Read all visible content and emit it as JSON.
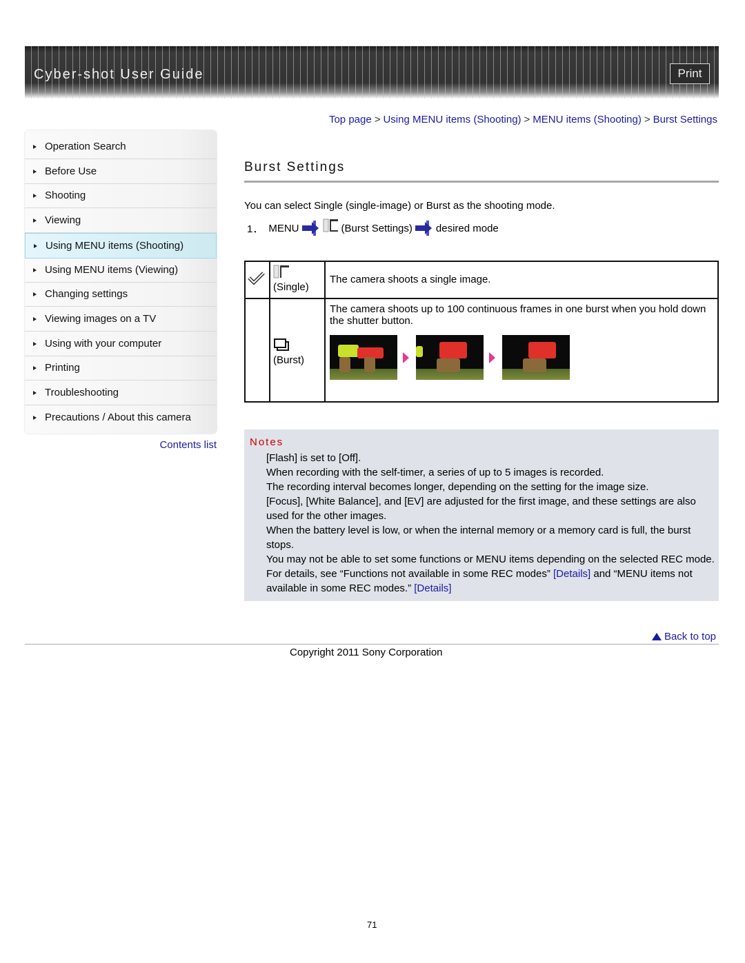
{
  "header": {
    "title": "Cyber-shot User Guide",
    "print_label": "Print"
  },
  "breadcrumb": [
    "Top page",
    "Using MENU items (Shooting)",
    "MENU items (Shooting)",
    "Burst Settings"
  ],
  "sidebar": {
    "items": [
      {
        "label": "Operation Search",
        "active": false
      },
      {
        "label": "Before Use",
        "active": false
      },
      {
        "label": "Shooting",
        "active": false
      },
      {
        "label": "Viewing",
        "active": false
      },
      {
        "label": "Using MENU items (Shooting)",
        "active": true
      },
      {
        "label": "Using MENU items (Viewing)",
        "active": false
      },
      {
        "label": "Changing settings",
        "active": false
      },
      {
        "label": "Viewing images on a TV",
        "active": false
      },
      {
        "label": "Using with your computer",
        "active": false
      },
      {
        "label": "Printing",
        "active": false
      },
      {
        "label": "Troubleshooting",
        "active": false
      },
      {
        "label": "Precautions / About this camera",
        "active": false
      }
    ],
    "contents_list": "Contents list"
  },
  "main": {
    "title": "Burst Settings",
    "intro": "You can select Single (single-image) or Burst as the shooting mode.",
    "step": {
      "number": "1．",
      "menu": "MENU",
      "setting": "(Burst Settings)",
      "target": "desired mode"
    },
    "modes": [
      {
        "label": "(Single)",
        "selected": true,
        "description": "The camera shoots a single image."
      },
      {
        "label": "(Burst)",
        "selected": false,
        "description": "The camera shoots up to 100 continuous frames in one burst when you hold down the shutter button."
      }
    ]
  },
  "notes": {
    "title": "Notes",
    "items": [
      "[Flash] is set to [Off].",
      "When recording with the self-timer, a series of up to 5 images is recorded.",
      "The recording interval becomes longer, depending on the setting for the image size.",
      "[Focus], [White Balance], and [EV] are adjusted for the first image, and these settings are also used for the other images.",
      "When the battery level is low, or when the internal memory or a memory card is full, the burst stops."
    ],
    "last_item": {
      "text1": "You may not be able to set some functions or MENU items depending on the selected REC mode. For details, see “Functions not available in some REC modes” ",
      "link1": "[Details]",
      "text2": " and “MENU items not available in some REC modes.” ",
      "link2": "[Details]"
    }
  },
  "footer": {
    "back_to_top": "Back to top",
    "copyright": "Copyright 2011 Sony Corporation",
    "page_number": "71"
  }
}
